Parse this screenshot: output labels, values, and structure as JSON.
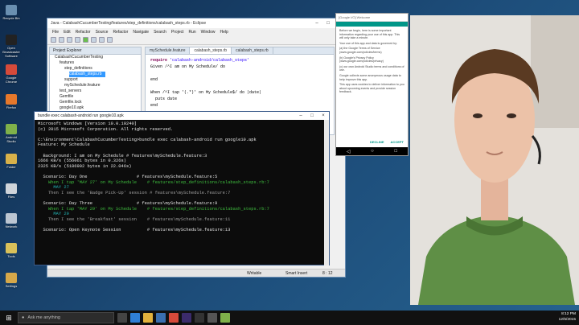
{
  "desktop": {
    "icons": [
      {
        "label": "Recycle Bin",
        "color": "#6a8fb0"
      },
      {
        "label": "Open Broadcaster Software",
        "color": "#222222"
      },
      {
        "label": "Google Chrome",
        "color": "#d64a3a"
      },
      {
        "label": "Firefox",
        "color": "#e6782b"
      },
      {
        "label": "Android Studio",
        "color": "#7fb14a"
      },
      {
        "label": "Folder",
        "color": "#d8b14a"
      },
      {
        "label": "Files",
        "color": "#cfd4da"
      },
      {
        "label": "Network",
        "color": "#bcc6d2"
      },
      {
        "label": "Tools",
        "color": "#d9c15a"
      },
      {
        "label": "Settings",
        "color": "#d6a84a"
      }
    ]
  },
  "eclipse": {
    "title": "Java - CalabashCucumberTesting/features/step_definitions/calabash_steps.rb - Eclipse",
    "menu": [
      "File",
      "Edit",
      "Refactor",
      "Source",
      "Refactor",
      "Navigate",
      "Search",
      "Project",
      "Run",
      "Window",
      "Help"
    ],
    "project_tab": "Project Explorer",
    "tree": [
      {
        "label": "CalabashCucumberTesting",
        "indent": 1
      },
      {
        "label": "features",
        "indent": 2
      },
      {
        "label": "step_definitions",
        "indent": 3
      },
      {
        "label": "calabash_steps.rb",
        "indent": 4,
        "selected": true
      },
      {
        "label": "support",
        "indent": 3
      },
      {
        "label": "mySchedule.feature",
        "indent": 3
      },
      {
        "label": "test_servers",
        "indent": 2
      },
      {
        "label": "Gemfile",
        "indent": 2
      },
      {
        "label": "Gemfile.lock",
        "indent": 2
      },
      {
        "label": "google10.apk",
        "indent": 2
      }
    ],
    "editor_tabs": [
      "mySchedule.feature",
      "calabash_steps.rb",
      "calabash_steps.rb"
    ],
    "code": {
      "line1_kw": "require",
      "line1_str": " 'calabash-android/calabash_steps'",
      "line2": "Given /^I am on My Schedule/ do",
      "line3": "end",
      "line4": "When /^I tap '(.*)' on My Schedule$/ do |date|",
      "line5": "  puts date",
      "line6": "end"
    },
    "status": {
      "left": "Writable",
      "middle": "Smart Insert",
      "right": "8 : 12"
    }
  },
  "terminal": {
    "title": "bundle exec calabash-android run google10.apk",
    "lines": [
      {
        "text": "Microsoft Windows [Version 10.0.10240]",
        "style": "t-wh"
      },
      {
        "text": "(c) 2015 Microsoft Corporation. All rights reserved.",
        "style": "t-wh"
      },
      {
        "text": " ",
        "style": "t-wh"
      },
      {
        "text": "C:\\Environment\\CalabashCucumberTesting>bundle exec calabash-android run google10.apk",
        "style": "t-wh"
      },
      {
        "text": "Feature: My Schedule",
        "style": "t-wh"
      },
      {
        "text": " ",
        "style": "t-wh"
      },
      {
        "text": "  Background: I am on My Schedule # features\\mySchedule.feature:3",
        "style": "t-wh"
      },
      {
        "text": "1666 KB/s (556061 bytes in 0.326s)",
        "style": "t-wh"
      },
      {
        "text": "2325 KB/s (5186902 bytes in 22.046s)",
        "style": "t-wh"
      },
      {
        "text": " ",
        "style": "t-wh"
      },
      {
        "text": "  Scenario: Day One                   # features\\mySchedule.feature:5",
        "style": "t-wh"
      },
      {
        "text": "    When I tap 'MAY 27' on My Schedule    # features/step_definitions/calabash_steps.rb:7",
        "style": "t-green"
      },
      {
        "text": "      MAY 27",
        "style": "t-cyan"
      },
      {
        "text": "    Then I see the 'Badge Pick-Up' session # features\\mySchedule.feature:7",
        "style": "t-dim"
      },
      {
        "text": " ",
        "style": "t-wh"
      },
      {
        "text": "  Scenario: Day Three                 # features\\mySchedule.feature:9",
        "style": "t-wh"
      },
      {
        "text": "    When I tap 'MAY 29' on My Schedule    # features/step_definitions/calabash_steps.rb:7",
        "style": "t-green"
      },
      {
        "text": "      MAY 29",
        "style": "t-cyan"
      },
      {
        "text": "    Then I see the 'Breakfast' session    # features\\mySchedule.feature:11",
        "style": "t-dim"
      },
      {
        "text": " ",
        "style": "t-wh"
      },
      {
        "text": "  Scenario: Open Keynote Session          # features\\mySchedule.feature:13",
        "style": "t-wh"
      }
    ]
  },
  "phone": {
    "title": "[Google I/O] Welcome",
    "paragraphs": [
      "Before we begin, here is some important information regarding your use of this app. This will only take a minute.",
      "Your use of this app and data is governed by:",
      "(a) the Google Terms of Service (www.google.com/policies/terms)",
      "(b) Google's Privacy Policy (www.google.com/policies/privacy)",
      "(c) our own Android Studio terms and conditions of use.",
      "Google collects some anonymous usage data to help improve this app.",
      "This app uses cookies to deliver information to you about upcoming events and provide session feedback."
    ],
    "decline": "DECLINE",
    "accept": "ACCEPT"
  },
  "taskbar": {
    "search_placeholder": "Ask me anything",
    "time": "8:12 PM",
    "date": "12/5/2015"
  }
}
